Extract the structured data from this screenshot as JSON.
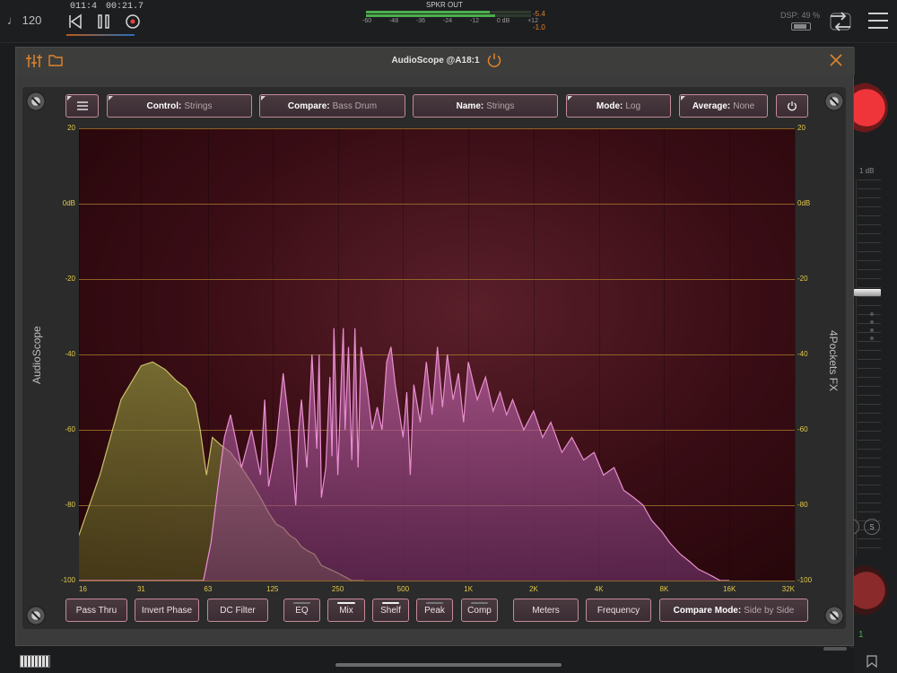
{
  "host": {
    "tempo": "♩ 120",
    "position": "011:4",
    "clock": "00:21.7",
    "output_label": "SPKR OUT",
    "meter_scale": [
      "-60",
      "-48",
      "-36",
      "-24",
      "-12",
      "0 dB",
      "+12"
    ],
    "meter_peak_top": "-5.4",
    "meter_peak_bottom": "-1.0",
    "meter_level_top": 0.75,
    "meter_level_bottom": 0.78,
    "dsp": "DSP: 49 %",
    "strip_db": "1 dB",
    "strip_number": "1",
    "s_labels": [
      "S",
      "S"
    ]
  },
  "plugin": {
    "title": "AudioScope @A18:1",
    "left_label": "AudioScope",
    "right_label": "4Pockets FX"
  },
  "top_controls": {
    "control": {
      "label": "Control:",
      "value": "Strings"
    },
    "compare": {
      "label": "Compare:",
      "value": "Bass Drum"
    },
    "name": {
      "label": "Name:",
      "value": "Strings"
    },
    "mode": {
      "label": "Mode:",
      "value": "Log"
    },
    "average": {
      "label": "Average:",
      "value": "None"
    }
  },
  "bottom_controls": {
    "pass_thru": "Pass Thru",
    "invert_phase": "Invert Phase",
    "dc_filter": "DC Filter",
    "eq": "EQ",
    "mix": "Mix",
    "shelf": "Shelf",
    "peak": "Peak",
    "comp": "Comp",
    "meters": "Meters",
    "frequency": "Frequency",
    "compare_mode_label": "Compare Mode:",
    "compare_mode_value": "Side by Side"
  },
  "toggles": {
    "eq": false,
    "mix": true,
    "shelf": true,
    "peak": false,
    "comp": false
  },
  "colors": {
    "accent": "#c58a97",
    "grid": "#a0712a",
    "strings": "#e98fd0",
    "bass_drum": "#c9c06a",
    "label": "#e5c94a"
  },
  "chart_data": {
    "type": "area",
    "xscale": "log",
    "xlim": [
      16,
      32000
    ],
    "ylim": [
      -100,
      20
    ],
    "y_ticks": [
      "20",
      "0dB",
      "-20",
      "-40",
      "-60",
      "-80",
      "-100"
    ],
    "x_ticks": [
      "16",
      "31",
      "63",
      "125",
      "250",
      "500",
      "1K",
      "2K",
      "4K",
      "8K",
      "16K",
      "32K"
    ],
    "series": [
      {
        "name": "Bass Drum",
        "x": [
          16,
          20,
          25,
          31,
          35,
          40,
          45,
          50,
          55,
          58,
          62,
          66,
          72,
          80,
          90,
          100,
          110,
          120,
          130,
          140,
          150,
          160,
          170,
          180,
          195,
          210,
          230,
          250,
          270,
          290,
          310,
          330
        ],
        "y": [
          -88,
          -72,
          -52,
          -43,
          -42,
          -44,
          -47,
          -49,
          -53,
          -60,
          -72,
          -62,
          -64,
          -66,
          -70,
          -74,
          -78,
          -82,
          -85,
          -86,
          -88,
          -89,
          -91,
          -92,
          -93,
          -96,
          -97,
          -98,
          -99,
          -100,
          -100,
          -100
        ]
      },
      {
        "name": "Strings",
        "x": [
          16,
          60,
          65,
          70,
          75,
          80,
          90,
          100,
          110,
          115,
          120,
          130,
          140,
          150,
          160,
          165,
          170,
          180,
          190,
          200,
          205,
          210,
          220,
          230,
          235,
          240,
          250,
          260,
          265,
          270,
          280,
          290,
          300,
          310,
          320,
          340,
          360,
          380,
          400,
          420,
          440,
          460,
          500,
          520,
          540,
          560,
          600,
          640,
          680,
          720,
          760,
          800,
          850,
          900,
          950,
          1000,
          1100,
          1200,
          1300,
          1400,
          1500,
          1600,
          1800,
          2000,
          2200,
          2400,
          2700,
          3000,
          3400,
          3800,
          4200,
          4700,
          5200,
          5800,
          6400,
          7000,
          7800,
          8500,
          9500,
          10500,
          11500,
          12500,
          13500,
          14500,
          15500,
          16000
        ],
        "y": [
          -100,
          -100,
          -90,
          -75,
          -62,
          -56,
          -70,
          -60,
          -72,
          -52,
          -75,
          -64,
          -45,
          -60,
          -80,
          -60,
          -52,
          -70,
          -40,
          -65,
          -40,
          -78,
          -70,
          -46,
          -67,
          -33,
          -72,
          -45,
          -33,
          -60,
          -38,
          -68,
          -33,
          -70,
          -38,
          -48,
          -60,
          -54,
          -60,
          -42,
          -38,
          -48,
          -62,
          -50,
          -72,
          -48,
          -58,
          -42,
          -56,
          -38,
          -54,
          -40,
          -52,
          -45,
          -58,
          -42,
          -52,
          -46,
          -55,
          -50,
          -56,
          -52,
          -60,
          -55,
          -62,
          -58,
          -66,
          -62,
          -68,
          -66,
          -72,
          -70,
          -76,
          -78,
          -80,
          -84,
          -87,
          -90,
          -93,
          -95,
          -97,
          -98,
          -99,
          -100,
          -100,
          -100
        ]
      }
    ]
  }
}
